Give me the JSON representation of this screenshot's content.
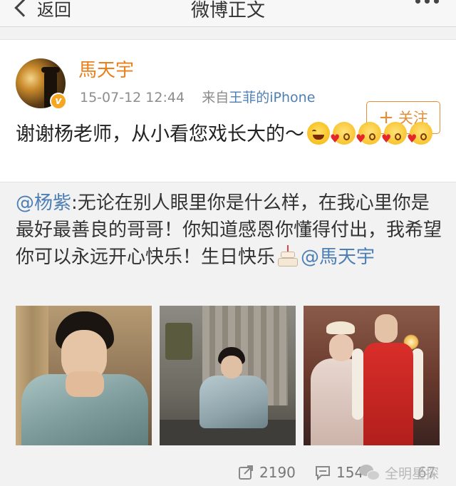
{
  "nav": {
    "back_label": "返回",
    "title": "微博正文"
  },
  "post": {
    "username": "馬天宇",
    "time": "15-07-12 12:44",
    "source_prefix": "来自",
    "source_name": "王菲的iPhone",
    "follow_label": "关注",
    "follow_plus": "+",
    "verified_badge": "v",
    "text": "谢谢杨老师，从小看您戏长大的～",
    "emojis": [
      "laugh-emoji",
      "kiss-emoji",
      "kiss-emoji",
      "kiss-emoji",
      "kiss-emoji"
    ]
  },
  "repost": {
    "author_mention": "@杨紫",
    "text": ":无论在别人眼里你是什么样，在我心里你是最好最善良的哥哥！你知道感恩你懂得付出，我希望你可以永远开心快乐！生日快乐",
    "tail_mention": "@馬天宇",
    "photo_count": 3
  },
  "actions": {
    "repost_count": "2190",
    "comment_count": "154",
    "like_count": "67"
  },
  "watermark": {
    "text": "全明星探"
  },
  "colors": {
    "username": "#e8801c",
    "link": "#4d7fb4",
    "follow_border": "#e58e3a",
    "badge": "#f5a623"
  }
}
